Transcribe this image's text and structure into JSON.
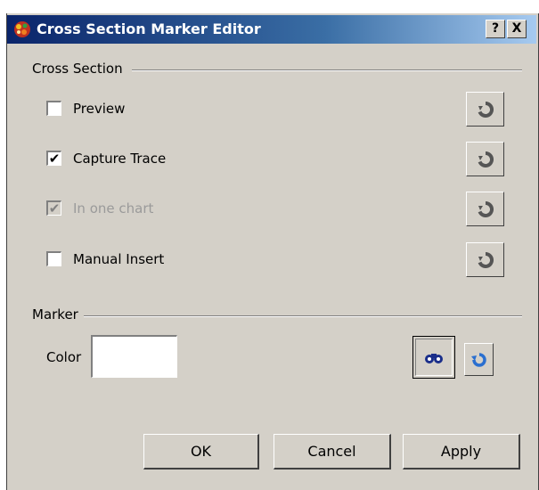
{
  "window": {
    "title": "Cross Section Marker Editor",
    "help_label": "?",
    "close_label": "X"
  },
  "cross_section": {
    "group_label": "Cross Section",
    "items": [
      {
        "label": "Preview",
        "checked": false,
        "enabled": true,
        "mark": ""
      },
      {
        "label": "Capture Trace",
        "checked": true,
        "enabled": true,
        "mark": "✔"
      },
      {
        "label": "In one chart",
        "checked": true,
        "enabled": false,
        "mark": "✔"
      },
      {
        "label": "Manual Insert",
        "checked": false,
        "enabled": true,
        "mark": ""
      }
    ]
  },
  "marker": {
    "group_label": "Marker",
    "color_label": "Color",
    "color_value": "#ffffff"
  },
  "buttons": {
    "ok": "OK",
    "cancel": "Cancel",
    "apply": "Apply"
  },
  "icons": {
    "app": "app-logo-icon",
    "reset": "reset-icon",
    "pick": "binoculars-icon",
    "undo": "undo-icon"
  }
}
